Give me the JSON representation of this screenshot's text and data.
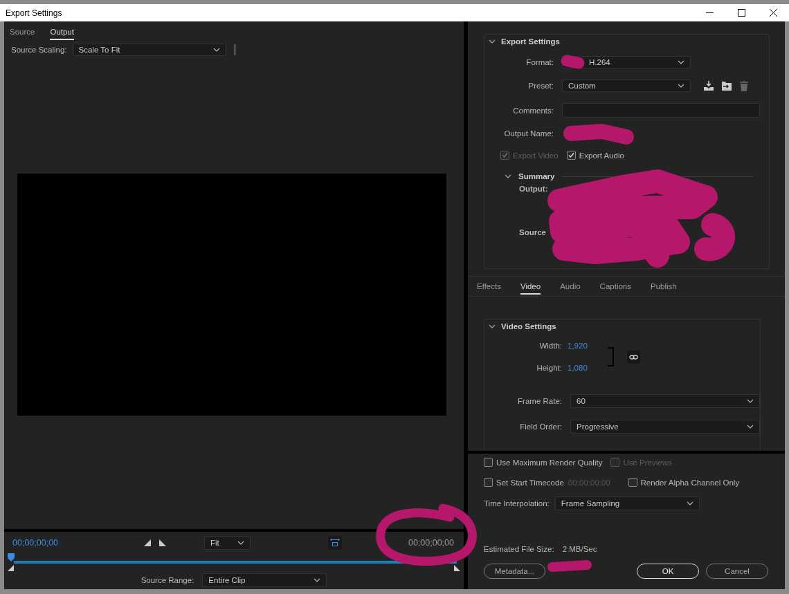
{
  "window": {
    "title": "Export Settings"
  },
  "left_tabs": [
    {
      "label": "Source",
      "selected": false
    },
    {
      "label": "Output",
      "selected": true
    }
  ],
  "source_scaling": {
    "label": "Source Scaling:",
    "value": "Scale To Fit"
  },
  "timeline": {
    "current_time": "00;00;00;00",
    "zoom": "Fit",
    "end_time": "00;00;00;00"
  },
  "source_range": {
    "label": "Source Range:",
    "value": "Entire Clip"
  },
  "export_settings": {
    "title": "Export Settings",
    "expanded": true,
    "format": {
      "label": "Format:",
      "value": "H.264"
    },
    "preset": {
      "label": "Preset:",
      "value": "Custom"
    },
    "comments": {
      "label": "Comments:"
    },
    "output_name": {
      "label": "Output Name:"
    },
    "checkboxes": [
      {
        "label": "Export Video",
        "checked": true,
        "disabled": true
      },
      {
        "label": "Export Audio",
        "checked": true,
        "disabled": false
      }
    ],
    "summary": {
      "title": "Summary",
      "expanded": true,
      "lines": [
        {
          "label": "Output:"
        },
        {
          "label": "Source"
        }
      ]
    }
  },
  "right_tabs": [
    {
      "label": "Effects",
      "selected": false
    },
    {
      "label": "Video",
      "selected": true
    },
    {
      "label": "Audio",
      "selected": false
    },
    {
      "label": "Captions",
      "selected": false
    },
    {
      "label": "Publish",
      "selected": false
    }
  ],
  "video_settings": {
    "title": "Video Settings",
    "expanded": true,
    "width": {
      "label": "Width:",
      "value": "1,920"
    },
    "height": {
      "label": "Height:",
      "value": "1,080"
    },
    "frame_rate": {
      "label": "Frame Rate:",
      "value": "60"
    },
    "field_order": {
      "label": "Field Order:",
      "value": "Progressive"
    }
  },
  "options": [
    [
      {
        "label": "Use Maximum Render Quality",
        "checked": false,
        "disabled": false
      },
      {
        "label": "Use Previews",
        "checked": false,
        "disabled": true
      }
    ],
    [
      {
        "label": "Set Start Timecode",
        "checked": false,
        "disabled": false,
        "timecode": "00:00:00:00"
      },
      {
        "label": "Render Alpha Channel Only",
        "checked": false,
        "disabled": false
      }
    ]
  ],
  "time_interpolation": {
    "label": "Time Interpolation:",
    "value": "Frame Sampling"
  },
  "estimated_file_size": {
    "label": "Estimated File Size:",
    "value": "2 MB/Sec"
  },
  "buttons": [
    {
      "label": "Metadata...",
      "primary": false
    },
    {
      "label": "OK",
      "primary": true
    },
    {
      "label": "Cancel",
      "primary": false
    }
  ]
}
